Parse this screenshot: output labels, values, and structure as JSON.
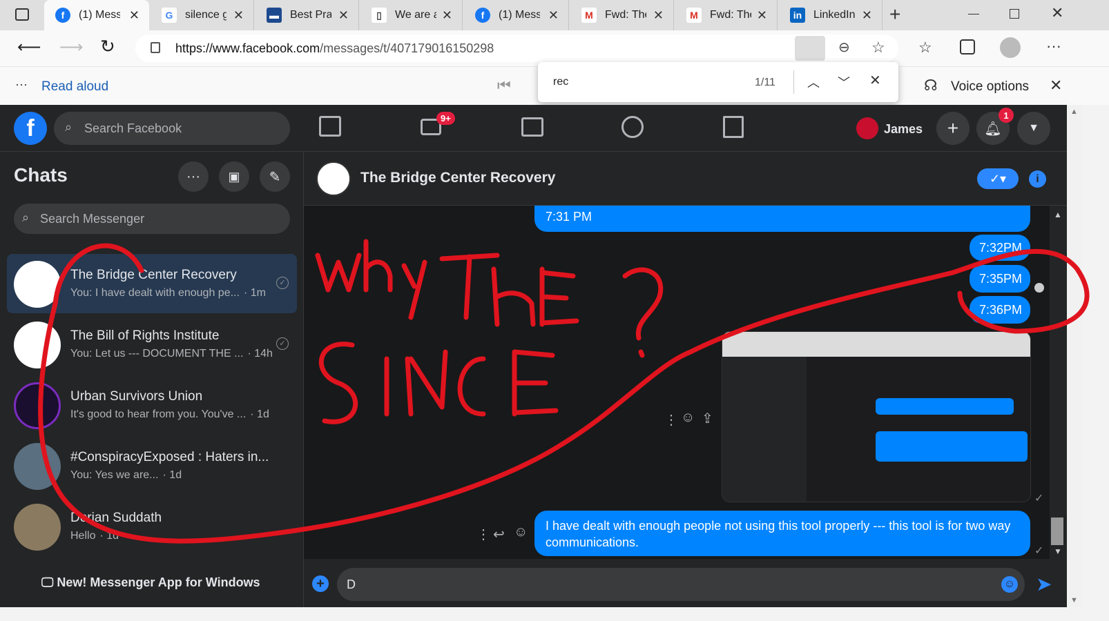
{
  "browser": {
    "tabs": [
      {
        "label": "(1) Messenger",
        "icon": "facebook-icon"
      },
      {
        "label": "silence g",
        "icon": "google-icon"
      },
      {
        "label": "Best Prac",
        "icon": "site-icon"
      },
      {
        "label": "We are a",
        "icon": "page-icon"
      },
      {
        "label": "(1) Messenger",
        "icon": "facebook-icon"
      },
      {
        "label": "Fwd: The",
        "icon": "gmail-icon"
      },
      {
        "label": "Fwd: The",
        "icon": "gmail-icon"
      },
      {
        "label": "LinkedIn",
        "icon": "linkedin-icon"
      }
    ],
    "url_domain": "https://www.facebook.com",
    "url_path": "/messages/t/407179016150298",
    "read_aloud": "Read aloud",
    "voice_options": "Voice options",
    "find": {
      "query": "rec",
      "count": "1/11"
    }
  },
  "facebook": {
    "search_placeholder": "Search Facebook",
    "user_name": "James",
    "video_badge": "9+",
    "notif_badge": "1"
  },
  "sidebar": {
    "title": "Chats",
    "search_placeholder": "Search Messenger",
    "chats": [
      {
        "name": "The Bridge Center Recovery",
        "preview": "You: I have dealt with enough pe...",
        "time": "· 1m"
      },
      {
        "name": "The Bill of Rights Institute",
        "preview": "You: Let us --- DOCUMENT THE ...",
        "time": "· 14h"
      },
      {
        "name": "Urban Survivors Union",
        "preview": "It's good to hear from you. You've ...",
        "time": "· 1d"
      },
      {
        "name": "#ConspiracyExposed : Haters in...",
        "preview": "You: Yes we are...",
        "time": "· 1d"
      },
      {
        "name": "Dorian Suddath",
        "preview": "Hello",
        "time": "· 1d"
      }
    ],
    "promo": "New! Messenger App for Windows"
  },
  "conversation": {
    "title": "The Bridge Center Recovery",
    "messages": [
      {
        "text": "7:31 PM"
      },
      {
        "text": "7:32PM"
      },
      {
        "text": "7:35PM"
      },
      {
        "text": "7:36PM"
      },
      {
        "text": "I have dealt with enough people not using this tool properly --- this tool is for two way communications."
      }
    ],
    "composer_value": "D"
  },
  "annotation": {
    "text": "Why The Silence?",
    "color": "#e0141e"
  },
  "colors": {
    "messenger_blue": "#0084ff",
    "dark_bg": "#18191a",
    "panel_bg": "#242526"
  }
}
